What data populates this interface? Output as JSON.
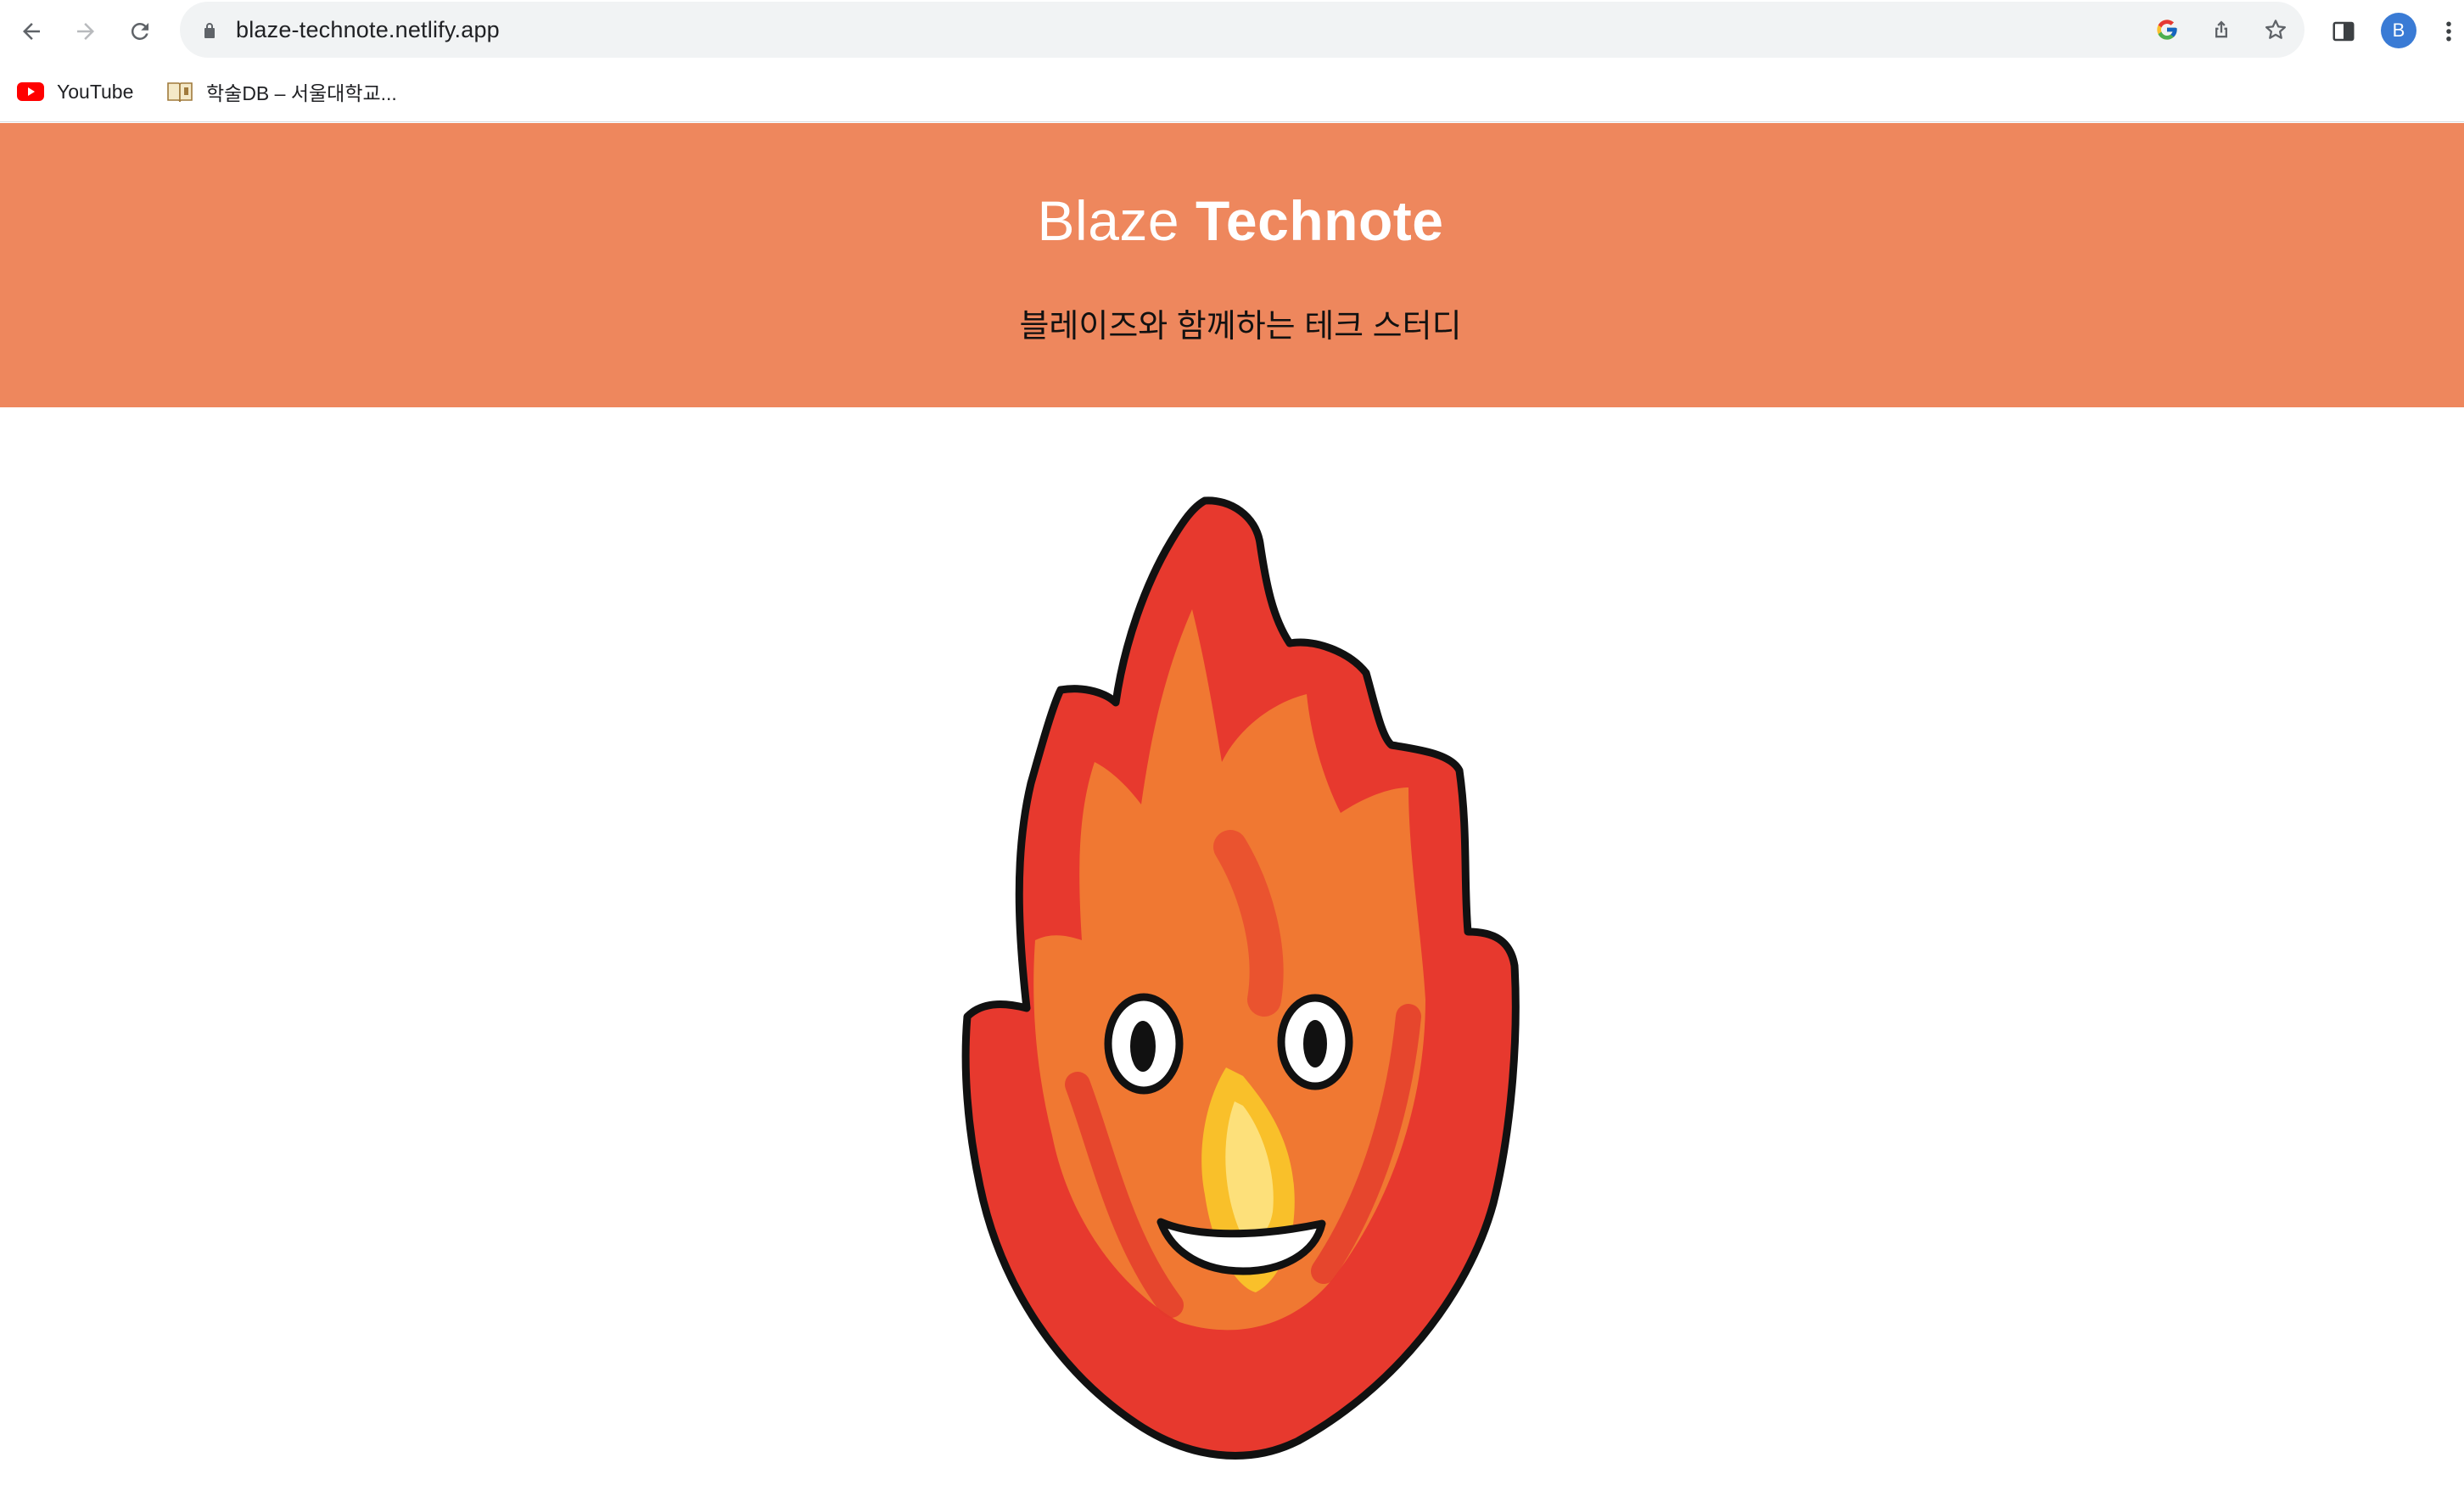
{
  "browser": {
    "url": "blaze-technote.netlify.app",
    "profile_initial": "B",
    "icons": {
      "back": "arrow-left-icon",
      "forward": "arrow-right-icon",
      "reload": "reload-icon",
      "lock": "lock-icon",
      "google": "google-icon",
      "share": "share-icon",
      "bookmark": "star-icon",
      "side_panel": "side-panel-icon",
      "menu": "more-vert-icon"
    }
  },
  "bookmarks": [
    {
      "label": "YouTube",
      "icon": "youtube-icon"
    },
    {
      "label": "학술DB – 서울대학교...",
      "icon": "book-icon"
    }
  ],
  "page": {
    "title_light": "Blaze",
    "title_bold": "Technote",
    "subtitle": "블레이즈와 함께하는 테크 스터디",
    "hero_color": "#ee875d",
    "mascot": "flame-mascot"
  }
}
